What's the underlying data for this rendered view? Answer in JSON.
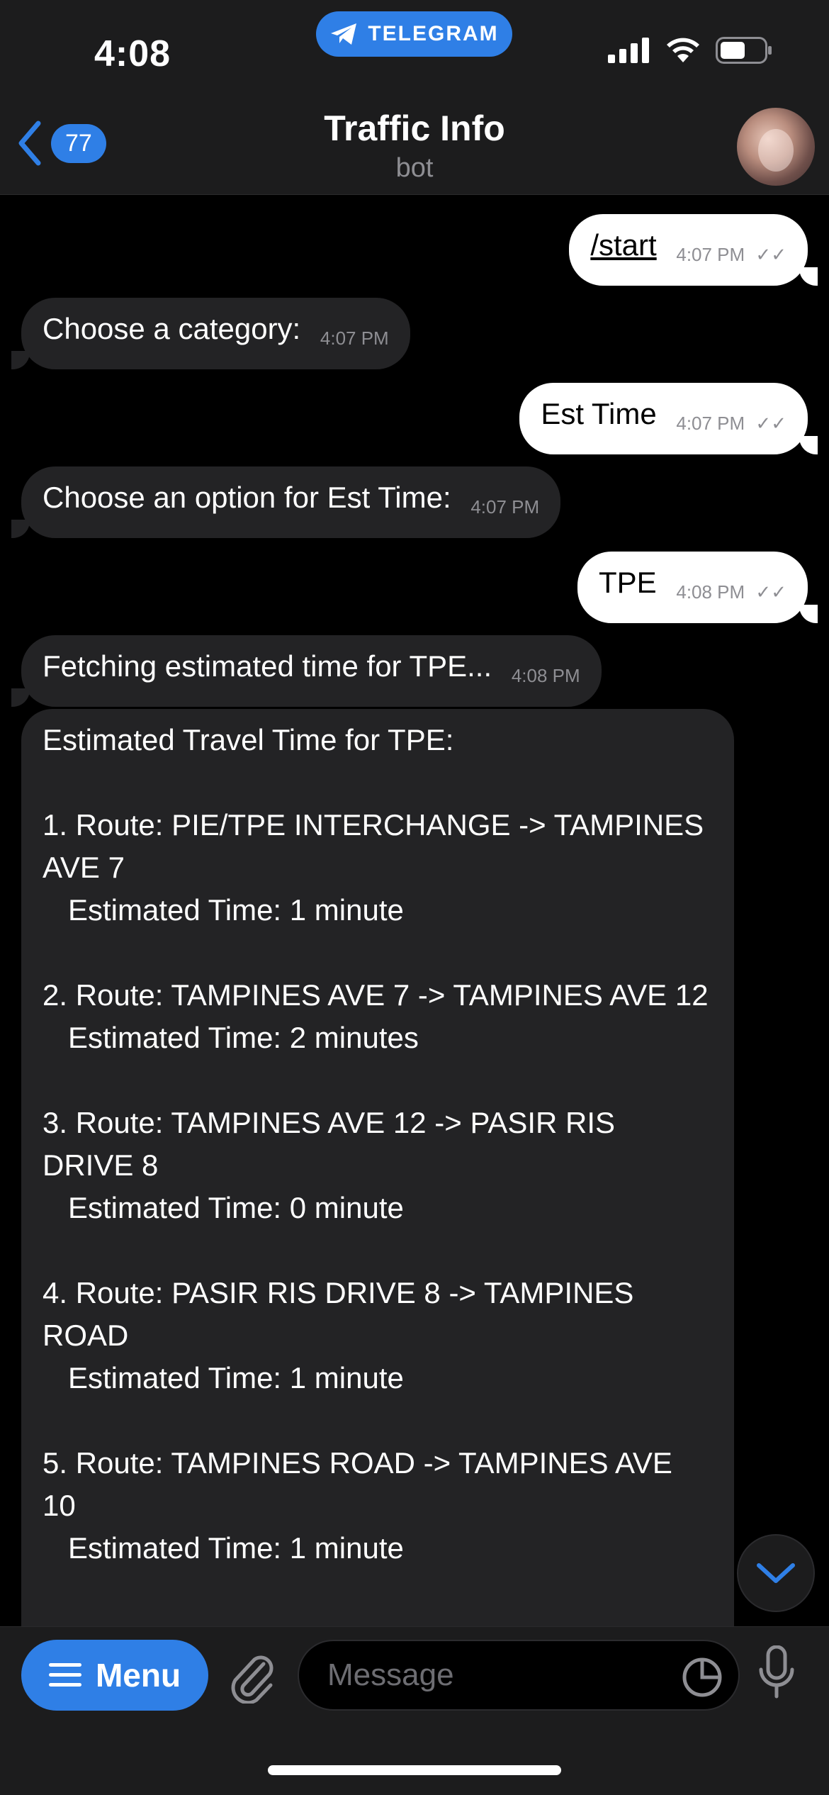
{
  "status_bar": {
    "time": "4:08",
    "app_pill": "TELEGRAM"
  },
  "header": {
    "back_badge": "77",
    "title": "Traffic Info",
    "subtitle": "bot"
  },
  "messages": [
    {
      "dir": "out",
      "text": "/start",
      "time": "4:07 PM",
      "ticks": "✓✓"
    },
    {
      "dir": "in",
      "text": "Choose a category:",
      "time": "4:07 PM"
    },
    {
      "dir": "out",
      "text": "Est Time",
      "time": "4:07 PM",
      "ticks": "✓✓"
    },
    {
      "dir": "in",
      "text": "Choose an option for Est Time:",
      "time": "4:07 PM"
    },
    {
      "dir": "out",
      "text": "TPE",
      "time": "4:08 PM",
      "ticks": "✓✓"
    },
    {
      "dir": "in",
      "text": "Fetching estimated time for TPE...",
      "time": "4:08 PM"
    }
  ],
  "long_message": {
    "heading": "Estimated Travel Time for TPE:",
    "routes": [
      {
        "route": "1. Route: PIE/TPE INTERCHANGE -> TAMPINES AVE 7",
        "time": "Estimated Time: 1 minute"
      },
      {
        "route": "2. Route: TAMPINES AVE 7 -> TAMPINES AVE 12",
        "time": "Estimated Time: 2 minutes"
      },
      {
        "route": "3. Route: TAMPINES AVE 12 -> PASIR RIS DRIVE 8",
        "time": "Estimated Time: 0 minute"
      },
      {
        "route": "4. Route: PASIR RIS DRIVE 8 -> TAMPINES ROAD",
        "time": "Estimated Time: 1 minute"
      },
      {
        "route": "5. Route: TAMPINES ROAD -> TAMPINES AVE 10",
        "time": "Estimated Time: 1 minute"
      }
    ]
  },
  "composer": {
    "menu_label": "Menu",
    "placeholder": "Message"
  },
  "colors": {
    "accent": "#2f7fe6",
    "incoming_bubble": "#232325",
    "outgoing_bubble": "#ffffff",
    "bar_bg": "#1c1c1d"
  }
}
